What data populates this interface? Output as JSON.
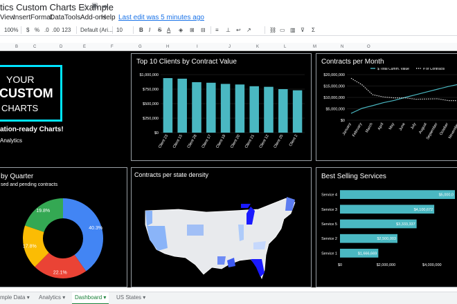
{
  "doc": {
    "title": "tics Custom Charts Example",
    "star_icon": "star-icon",
    "move_icon": "folder-icon",
    "cloud_icon": "cloud-icon"
  },
  "menu": {
    "items": [
      "View",
      "Insert",
      "Format",
      "Data",
      "Tools",
      "Add-ons",
      "Help"
    ],
    "last_edit": "Last edit was 5 minutes ago"
  },
  "toolbar": {
    "zoom": "100%",
    "currency": "$",
    "percent": "%",
    "dec_dec": ".0",
    "dec_inc": ".00",
    "format": "123",
    "font": "Default (Ari...",
    "size": "10",
    "bold": "B",
    "italic": "I",
    "strike": "S",
    "text_color": "A",
    "sigma": "Σ"
  },
  "columns": [
    "B",
    "C",
    "D",
    "E",
    "F",
    "G",
    "H",
    "I",
    "J",
    "K",
    "L",
    "M",
    "N",
    "O"
  ],
  "logo": {
    "line1": "YOUR",
    "line2": "CUSTOM",
    "line3": "CHARTS"
  },
  "tagline": "ation-ready Charts!",
  "subtitle": "Analytics",
  "quarter_title": "by Quarter",
  "quarter_sub": "sed and pending contracts",
  "tabs": {
    "items": [
      "mple Data",
      "Analytics",
      "Dashboard",
      "US States"
    ],
    "active": "Dashboard"
  },
  "chart_data": [
    {
      "type": "bar",
      "title": "Top 10 Clients by Contract Value",
      "categories": [
        "Client 23",
        "Client 15",
        "Client 28",
        "Client 17",
        "Client 18",
        "Client 20",
        "Client 21",
        "Client 12",
        "Client 25",
        "Client 2"
      ],
      "values": [
        940000,
        930000,
        870000,
        860000,
        840000,
        830000,
        800000,
        790000,
        750000,
        730000
      ],
      "ylim": [
        0,
        1000000
      ],
      "yticks": [
        "$0",
        "$250,000",
        "$500,000",
        "$750,000",
        "$1,000,000"
      ],
      "color": "#4ab8c2"
    },
    {
      "type": "line",
      "title": "Contracts per Month",
      "categories": [
        "January",
        "February",
        "March",
        "April",
        "May",
        "June",
        "July",
        "August",
        "September",
        "October",
        "November"
      ],
      "series": [
        {
          "name": "$ Total Cumm. Value",
          "values": [
            3000000,
            5200000,
            6400000,
            7700000,
            8700000,
            10000000,
            11200000,
            12400000,
            13600000,
            14800000,
            15800000
          ],
          "color": "#4ab8c2",
          "dash": false
        },
        {
          "name": "# of Contracts",
          "values": [
            18400000,
            15600000,
            11200000,
            10200000,
            9800000,
            9800000,
            9200000,
            9300000,
            9400000,
            8600000,
            8600000
          ],
          "color": "#dddddd",
          "dash": true
        }
      ],
      "ylim": [
        0,
        20000000
      ],
      "yticks": [
        "$0",
        "$5,000,000",
        "$10,000,000",
        "$15,000,000",
        "$20,000,000"
      ]
    },
    {
      "type": "pie",
      "title": "by Quarter",
      "values": [
        40.3,
        22.1,
        17.8,
        19.8
      ],
      "labels": [
        "40.3%",
        "22.1%",
        "17.8%",
        "19.8%"
      ],
      "colors": [
        "#4285f4",
        "#ea4335",
        "#fbbc04",
        "#34a853"
      ]
    },
    {
      "type": "map",
      "title": "Contracts per state density"
    },
    {
      "type": "bar",
      "title": "Best Selling Services",
      "orientation": "horizontal",
      "categories": [
        "Service 4",
        "Service 3",
        "Service 5",
        "Service 2",
        "Service 1"
      ],
      "values": [
        5000000,
        4100672,
        3333337,
        2500003,
        1666669
      ],
      "labels": [
        "$5,000,0",
        "$4,100,672",
        "$3,333,337",
        "$2,500,003",
        "$1,666,669"
      ],
      "xlim": [
        0,
        5000000
      ],
      "xticks": [
        "$0",
        "$2,000,000",
        "$4,000,000"
      ],
      "color": "#4ab8c2"
    }
  ]
}
